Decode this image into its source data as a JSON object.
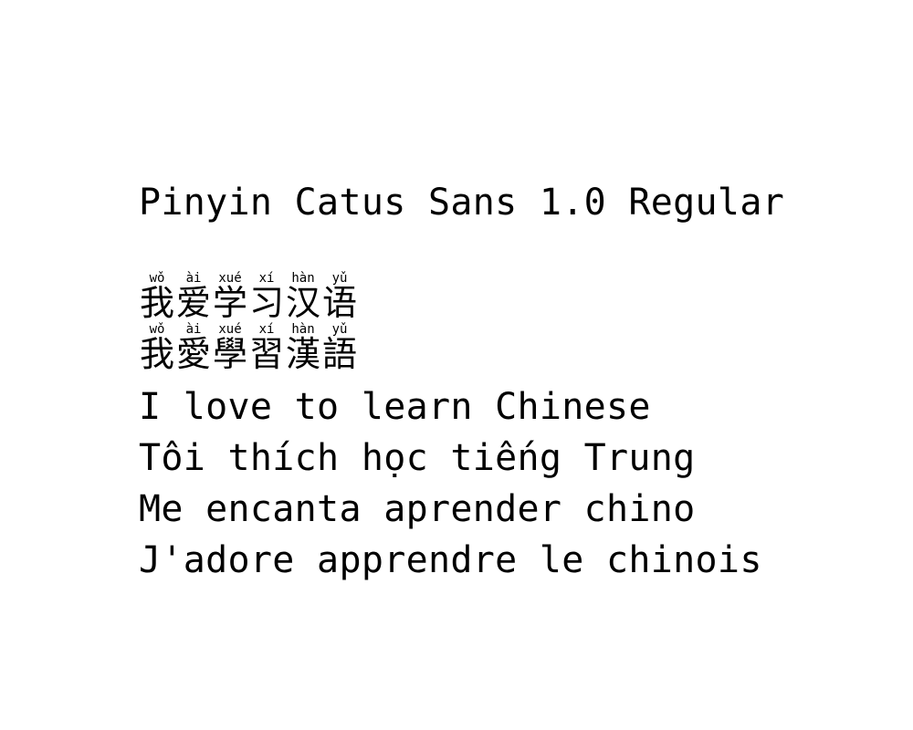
{
  "title": "Pinyin Catus Sans 1.0 Regular",
  "hanzi_lines": [
    {
      "chars": [
        {
          "pinyin": "wǒ",
          "hanzi": "我"
        },
        {
          "pinyin": "ài",
          "hanzi": "爱"
        },
        {
          "pinyin": "xué",
          "hanzi": "学"
        },
        {
          "pinyin": "xí",
          "hanzi": "习"
        },
        {
          "pinyin": "hàn",
          "hanzi": "汉"
        },
        {
          "pinyin": "yǔ",
          "hanzi": "语"
        }
      ]
    },
    {
      "chars": [
        {
          "pinyin": "wǒ",
          "hanzi": "我"
        },
        {
          "pinyin": "ài",
          "hanzi": "愛"
        },
        {
          "pinyin": "xué",
          "hanzi": "學"
        },
        {
          "pinyin": "xí",
          "hanzi": "習"
        },
        {
          "pinyin": "hàn",
          "hanzi": "漢"
        },
        {
          "pinyin": "yǔ",
          "hanzi": "語"
        }
      ]
    }
  ],
  "lines": {
    "english": "I love to learn Chinese",
    "vietnamese": "Tôi thích học tiếng Trung",
    "spanish": "Me encanta aprender chino",
    "french": "J'adore apprendre le chinois"
  }
}
